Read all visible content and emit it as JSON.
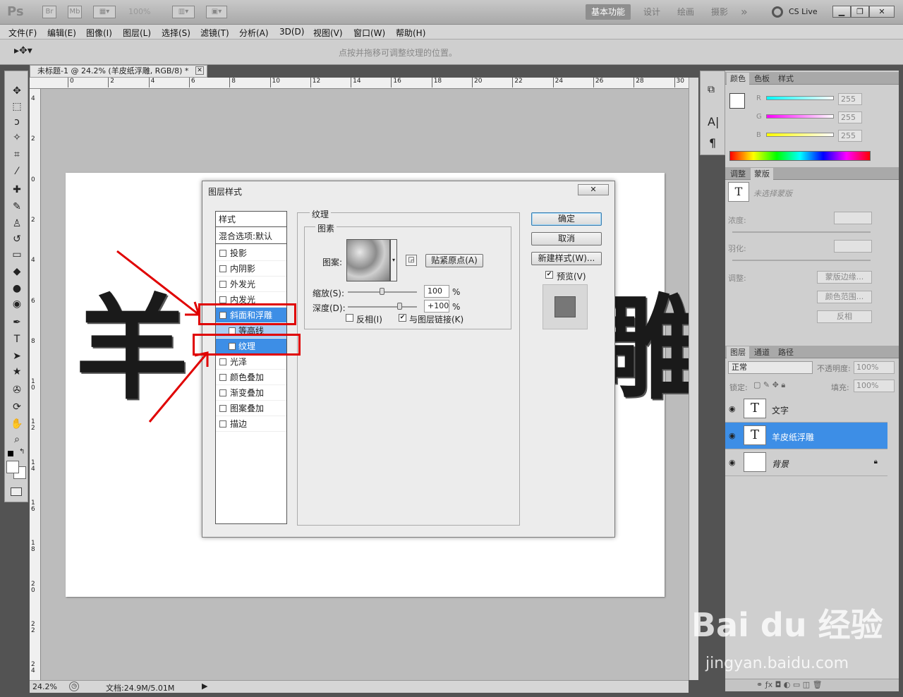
{
  "app": {
    "logo": "Ps",
    "zoom_badge": "100%",
    "btn_br": "Br",
    "btn_mb": "Mb",
    "workspaces": [
      "基本功能",
      "设计",
      "绘画",
      "摄影"
    ],
    "more": "»",
    "cslive": "CS Live"
  },
  "menu": [
    "文件(F)",
    "编辑(E)",
    "图像(I)",
    "图层(L)",
    "选择(S)",
    "滤镜(T)",
    "分析(A)",
    "3D(D)",
    "视图(V)",
    "窗口(W)",
    "帮助(H)"
  ],
  "options_hint": "点按并拖移可调整纹理的位置。",
  "document": {
    "tab_title": "未标题-1 @ 24.2% (羊皮纸浮雕, RGB/8) *",
    "canvas_text_left": "羊",
    "canvas_text_right": "雕",
    "ruler_top": [
      "0",
      "2",
      "4",
      "6",
      "8",
      "10",
      "12",
      "14",
      "16",
      "18",
      "20",
      "22",
      "24",
      "26",
      "28",
      "30"
    ],
    "ruler_left": [
      "4",
      "2",
      "0",
      "2",
      "4",
      "6",
      "8",
      "1 0",
      "1 2",
      "1 4",
      "1 6",
      "1 8",
      "2 0",
      "2 2",
      "2 4"
    ],
    "zoom": "24.2%",
    "doc_info": "文档:24.9M/5.01M"
  },
  "dialog": {
    "title": "图层样式",
    "style_header": "样式",
    "blend_options": "混合选项:默认",
    "styles": [
      {
        "label": "投影",
        "checked": false
      },
      {
        "label": "内阴影",
        "checked": false
      },
      {
        "label": "外发光",
        "checked": false
      },
      {
        "label": "内发光",
        "checked": false
      },
      {
        "label": "斜面和浮雕",
        "checked": true
      },
      {
        "label": "等高线",
        "checked": false
      },
      {
        "label": "纹理",
        "checked": true
      },
      {
        "label": "光泽",
        "checked": false
      },
      {
        "label": "颜色叠加",
        "checked": false
      },
      {
        "label": "渐变叠加",
        "checked": false
      },
      {
        "label": "图案叠加",
        "checked": false
      },
      {
        "label": "描边",
        "checked": false
      }
    ],
    "section_title": "纹理",
    "group_title": "图素",
    "pattern_label": "图案:",
    "snap_button": "贴紧原点(A)",
    "scale_label": "缩放(S):",
    "scale_value": "100",
    "scale_pct": 0.5,
    "depth_label": "深度(D):",
    "depth_value": "+100",
    "depth_pct": 0.75,
    "percent": "%",
    "invert_label": "反相(I)",
    "invert_checked": false,
    "link_label": "与图层链接(K)",
    "link_checked": true,
    "ok": "确定",
    "cancel": "取消",
    "new_style": "新建样式(W)...",
    "preview_label": "预览(V)",
    "preview_checked": true
  },
  "color_panel": {
    "tabs": [
      "颜色",
      "色板",
      "样式"
    ],
    "channels": [
      {
        "name": "R",
        "value": "255",
        "color": "#00ffff"
      },
      {
        "name": "G",
        "value": "255",
        "color": "#ff00ff"
      },
      {
        "name": "B",
        "value": "255",
        "color": "#ffff00"
      }
    ]
  },
  "masks_panel": {
    "tabs": [
      "调整",
      "蒙版"
    ],
    "no_mask": "未选择蒙版",
    "density": "浓度:",
    "feather": "羽化:",
    "refine": "调整:",
    "mask_edge": "蒙版边缘...",
    "color_range": "颜色范围...",
    "invert": "反相"
  },
  "layers_panel": {
    "tabs": [
      "图层",
      "通道",
      "路径"
    ],
    "blend_mode": "正常",
    "opacity_label": "不透明度:",
    "opacity_value": "100%",
    "lock_label": "锁定:",
    "fill_label": "填充:",
    "fill_value": "100%",
    "layers": [
      {
        "name": "文字",
        "thumb": "T",
        "selected": false
      },
      {
        "name": "羊皮纸浮雕",
        "thumb": "T",
        "selected": true
      },
      {
        "name": "背景",
        "thumb": "",
        "selected": false
      }
    ]
  },
  "watermark": {
    "brand": "Bai du 经验",
    "url": "jingyan.baidu.com"
  }
}
